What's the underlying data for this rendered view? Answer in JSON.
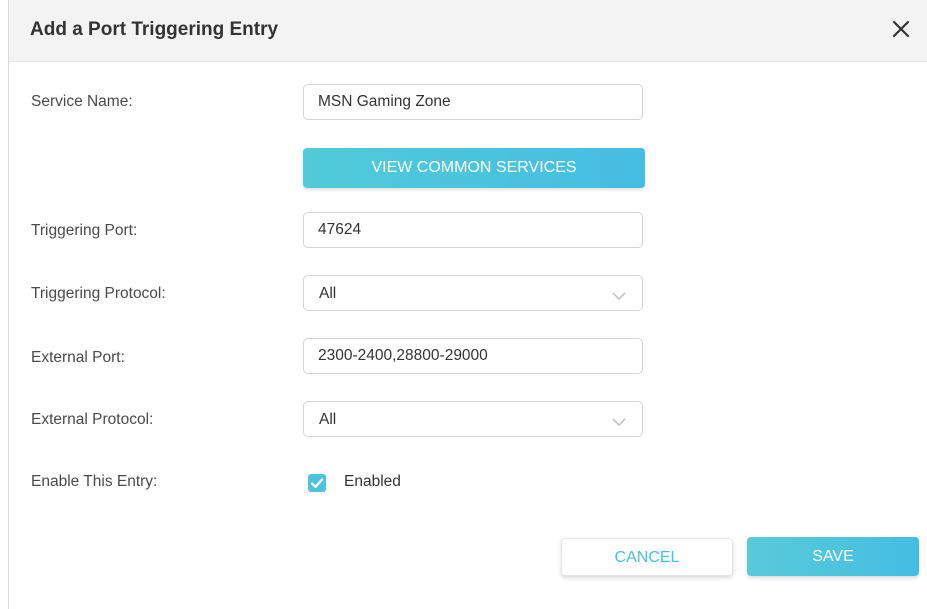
{
  "dialog": {
    "title": "Add a Port Triggering Entry",
    "close_icon": "close-icon"
  },
  "form": {
    "service_name": {
      "label": "Service Name:",
      "value": "MSN Gaming Zone"
    },
    "view_common_services_label": "VIEW COMMON SERVICES",
    "triggering_port": {
      "label": "Triggering Port:",
      "value": "47624"
    },
    "triggering_protocol": {
      "label": "Triggering Protocol:",
      "value": "All"
    },
    "external_port": {
      "label": "External Port:",
      "value": "2300-2400,28800-29000"
    },
    "external_protocol": {
      "label": "External Protocol:",
      "value": "All"
    },
    "enable_entry": {
      "label": "Enable This Entry:",
      "checkbox_label": "Enabled",
      "checked": true
    }
  },
  "footer": {
    "cancel_label": "CANCEL",
    "save_label": "SAVE"
  },
  "colors": {
    "accent": "#4ec3dc",
    "header_bg": "#f3f3f3"
  }
}
